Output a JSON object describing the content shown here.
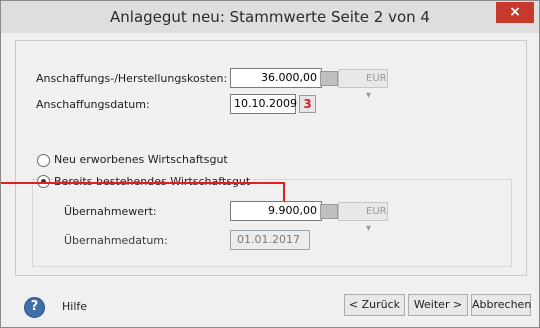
{
  "window": {
    "title": "Anlagegut neu: Stammwerte Seite 2 von 4",
    "close_label": "×"
  },
  "fields": {
    "cost_label": "Anschaffungs-/Herstellungskosten:",
    "cost_value": "36.000,00",
    "cost_currency": "EUR",
    "date_label": "Anschaffungsdatum:",
    "date_value": "10.10.2009",
    "calendar_glyph": "3"
  },
  "radios": [
    {
      "label": "Neu erworbenes Wirtschaftsgut",
      "selected": false
    },
    {
      "label": "Bereits bestehendes Wirtschaftsgut",
      "selected": true
    }
  ],
  "group": {
    "takeover_value_label": "Übernahmewert:",
    "takeover_value": "9.900,00",
    "takeover_currency": "EUR",
    "takeover_date_label": "Übernahmedatum:",
    "takeover_date": "01.01.2017"
  },
  "footer": {
    "help_label": "Hilfe",
    "back_label": "< Zurück",
    "next_label": "Weiter >",
    "cancel_label": "Abbrechen"
  },
  "colors": {
    "annotation_line": "#e02020",
    "close_button": "#c7382d"
  }
}
